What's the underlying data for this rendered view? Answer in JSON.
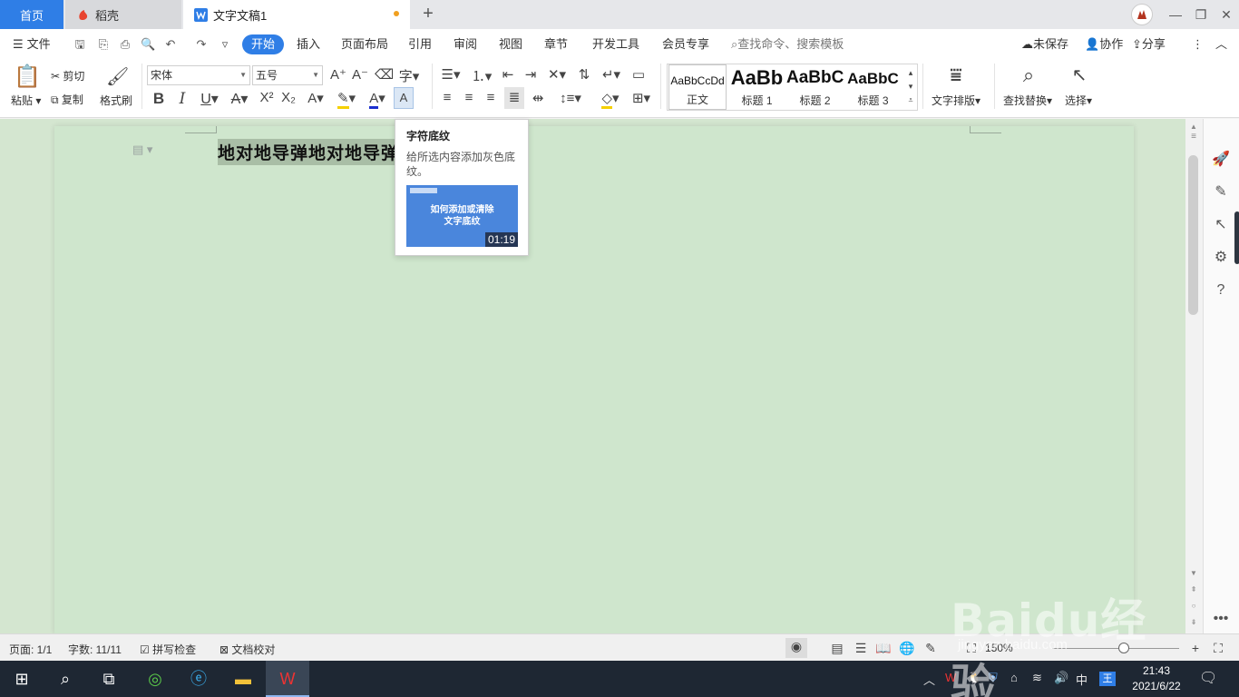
{
  "tabs": {
    "home": "首页",
    "daoke": "稻壳",
    "document": "文字文稿1",
    "add": "+"
  },
  "menu": {
    "file": "文件",
    "items": [
      "开始",
      "插入",
      "页面布局",
      "引用",
      "审阅",
      "视图",
      "章节",
      "开发工具",
      "会员专享"
    ],
    "active": "开始",
    "search_placeholder": "查找命令、搜索模板",
    "unsaved": "未保存",
    "collaborate": "协作",
    "share": "分享"
  },
  "ribbon": {
    "paste": "粘贴",
    "cut": "剪切",
    "copy": "复制",
    "format_painter": "格式刷",
    "font_name": "宋体",
    "font_size": "五号",
    "styles": [
      {
        "preview": "AaBbCcDd",
        "label": "正文"
      },
      {
        "preview": "AaBb",
        "label": "标题 1"
      },
      {
        "preview": "AaBbC",
        "label": "标题 2"
      },
      {
        "preview": "AaBbC",
        "label": "标题 3"
      }
    ],
    "text_layout": "文字排版",
    "find_replace": "查找替换",
    "select": "选择"
  },
  "document": {
    "text": "地对地导弹地对地导弹"
  },
  "tooltip": {
    "title": "字符底纹",
    "description": "给所选内容添加灰色底纹。",
    "video_title_line1": "如何添加或清除",
    "video_title_line2": "文字底纹",
    "video_duration": "01:19"
  },
  "status": {
    "page": "页面: 1/1",
    "words": "字数: 11/11",
    "spell_check": "拼写检查",
    "doc_proofread": "文档校对",
    "zoom": "150%"
  },
  "taskbar": {
    "ime": "中",
    "time": "21:43",
    "date": "2021/6/22"
  },
  "watermark": {
    "brand": "Baidu经验",
    "url": "jingyan.baidu.com"
  },
  "colors": {
    "accent": "#2f7ee6",
    "page_bg": "#cfe6cd",
    "highlight": "#a9bea6",
    "taskbar": "#1e2733"
  }
}
